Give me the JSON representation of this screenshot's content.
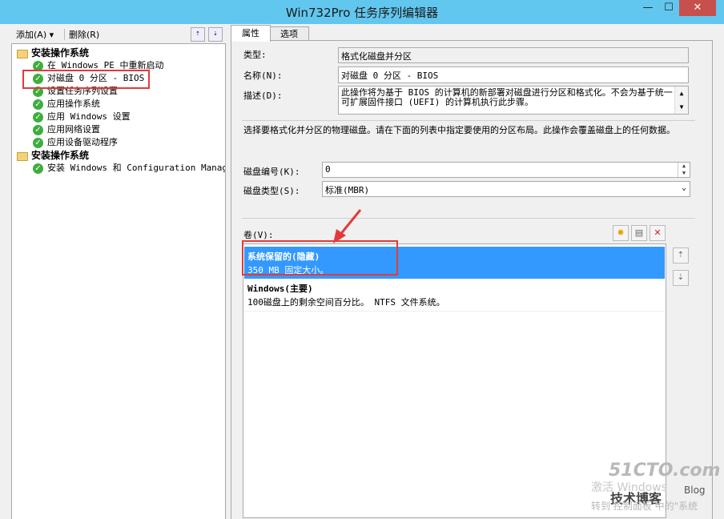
{
  "window": {
    "title": "Win732Pro 任务序列编辑器",
    "min_glyph": "—",
    "max_glyph": "☐",
    "close_glyph": "✕"
  },
  "toolbar": {
    "add_label": "添加(A) ▾",
    "delete_label": "删除(R)"
  },
  "tree": {
    "groups": [
      {
        "label": "安装操作系统",
        "items": [
          "在 Windows PE 中重新启动",
          "对磁盘 0 分区 - BIOS",
          "设置任务序列设置",
          "应用操作系统",
          "应用 Windows 设置",
          "应用网络设置",
          "应用设备驱动程序"
        ]
      },
      {
        "label": "安装操作系统",
        "items": [
          "安装 Windows 和 Configuration Manager"
        ]
      }
    ]
  },
  "tabs": {
    "properties": "属性",
    "options": "选项"
  },
  "form": {
    "type_label": "类型:",
    "type_value": "格式化磁盘并分区",
    "name_label": "名称(N):",
    "name_value": "对磁盘 0 分区 - BIOS",
    "desc_label": "描述(D):",
    "desc_value": "此操作将为基于 BIOS 的计算机的新部署对磁盘进行分区和格式化。不会为基于统一可扩展固件接口 (UEFI) 的计算机执行此步骤。",
    "instructions": "选择要格式化并分区的物理磁盘。请在下面的列表中指定要使用的分区布局。此操作会覆盖磁盘上的任何数据。",
    "disk_number_label": "磁盘编号(K):",
    "disk_number_value": "0",
    "disk_type_label": "磁盘类型(S):",
    "disk_type_value": "标准(MBR)",
    "volumes_label": "卷(V):"
  },
  "volumes": [
    {
      "name": "系统保留的(隐藏)",
      "desc": "350 MB 固定大小。",
      "selected": true
    },
    {
      "name": "Windows(主要)",
      "desc": "100磁盘上的剩余空间百分比。 NTFS 文件系统。",
      "selected": false
    }
  ],
  "watermark": {
    "site": "51CTO.com",
    "line1": "技术博客",
    "line2": "Blog",
    "line3": "激活 Windows",
    "line4": "转到 控制面板 中的\"系统"
  },
  "colors": {
    "titlebar": "#62c7ee",
    "close": "#c7504c",
    "selection": "#3399ff",
    "highlight_box": "#e23a3a"
  }
}
